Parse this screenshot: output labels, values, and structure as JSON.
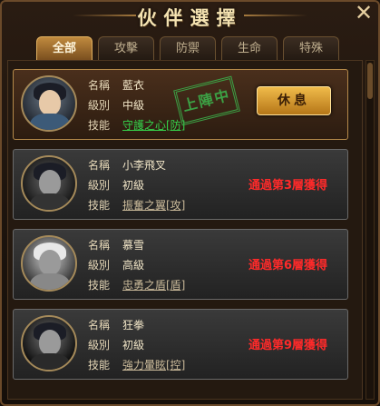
{
  "title": "伙伴選擇",
  "tabs": [
    {
      "label": "全部",
      "active": true
    },
    {
      "label": "攻擊",
      "active": false
    },
    {
      "label": "防禦",
      "active": false
    },
    {
      "label": "生命",
      "active": false
    },
    {
      "label": "特殊",
      "active": false
    }
  ],
  "labels": {
    "name": "名稱",
    "level": "級別",
    "skill": "技能"
  },
  "partners": [
    {
      "name": "藍衣",
      "level": "中級",
      "skill": "守護之心[防]",
      "stamp": "上陣中",
      "button": "休息",
      "selected": true
    },
    {
      "name": "小李飛叉",
      "level": "初級",
      "skill": "振奮之翼[攻]",
      "status": "通過第3層獲得"
    },
    {
      "name": "慕雪",
      "level": "高級",
      "skill": "忠勇之盾[盾]",
      "status": "通過第6層獲得"
    },
    {
      "name": "狂拳",
      "level": "初級",
      "skill": "強力暈眩[控]",
      "status": "通過第9層獲得"
    }
  ],
  "colors": {
    "accent": "#c08a3e",
    "active_skill": "#35d24a",
    "locked_status": "#ff2a2a"
  }
}
